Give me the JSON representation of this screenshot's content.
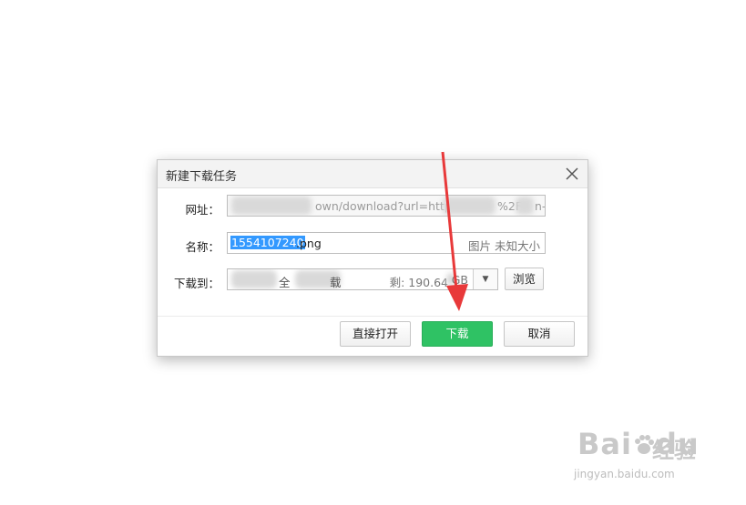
{
  "dialog": {
    "title": "新建下载任务",
    "url_label": "网址：",
    "url_value": "own/download?url=http",
    "url_tail": "%2F",
    "url_end": "n-",
    "name_label": "名称：",
    "name_selected": "1554107240",
    "name_ext": ".png",
    "name_type": "图片 未知大小",
    "dir_label": "下载到：",
    "dir_path_a": "全",
    "dir_path_b": "载",
    "dir_free": "剩: 190.64",
    "dir_free_unit": "GB",
    "browse_label": "浏览",
    "open_label": "直接打开",
    "download_label": "下载",
    "cancel_label": "取消"
  },
  "watermark": {
    "brand": "Bai",
    "brand_tail": "du",
    "cn": "经验",
    "url": "jingyan.baidu.com"
  },
  "colors": {
    "primary_green": "#2fc264",
    "selection_blue": "#3399ff",
    "arrow_red": "#e8393a"
  }
}
